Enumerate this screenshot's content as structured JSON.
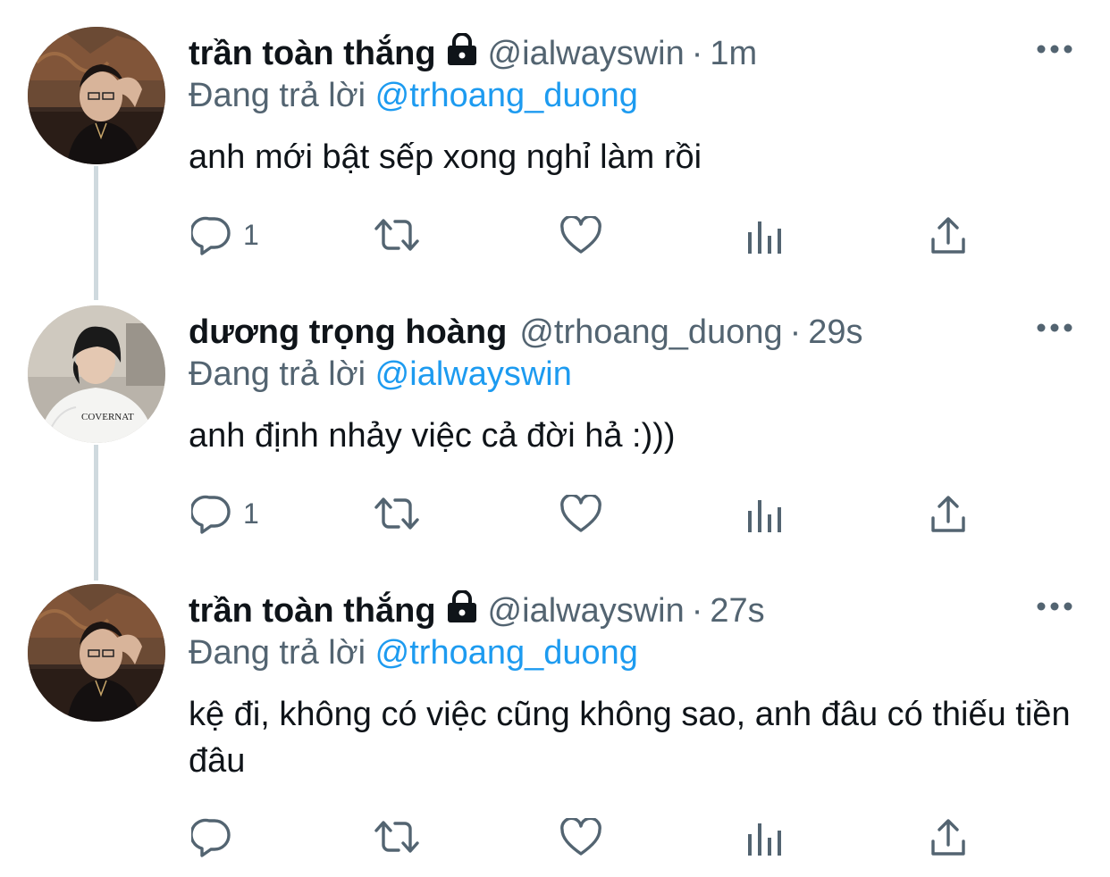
{
  "tweets": [
    {
      "name": "trần toàn thắng",
      "protected": true,
      "handle": "@ialwayswin",
      "separator": "·",
      "time": "1m",
      "replying_prefix": "Đang trả lời",
      "replying_to": "@trhoang_duong",
      "text": "anh mới bật sếp xong nghỉ làm rồi",
      "reply_count": "1"
    },
    {
      "name": "dương trọng hoàng",
      "protected": false,
      "handle": "@trhoang_duong",
      "separator": "·",
      "time": "29s",
      "replying_prefix": "Đang trả lời",
      "replying_to": "@ialwayswin",
      "text": "anh định nhảy việc cả đời hả :)))",
      "reply_count": "1"
    },
    {
      "name": "trần toàn thắng",
      "protected": true,
      "handle": "@ialwayswin",
      "separator": "·",
      "time": "27s",
      "replying_prefix": "Đang trả lời",
      "replying_to": "@trhoang_duong",
      "text": "kệ đi, không có việc cũng không sao, anh đâu có thiếu tiền đâu",
      "reply_count": ""
    }
  ],
  "icons": {
    "reply": "reply-icon",
    "retweet": "retweet-icon",
    "like": "like-icon",
    "analytics": "analytics-icon",
    "share": "share-icon",
    "more": "more-icon",
    "lock": "lock-icon"
  },
  "colors": {
    "text": "#0f1419",
    "secondary": "#536471",
    "link": "#1d9bf0",
    "thread_line": "#cfd9de"
  }
}
